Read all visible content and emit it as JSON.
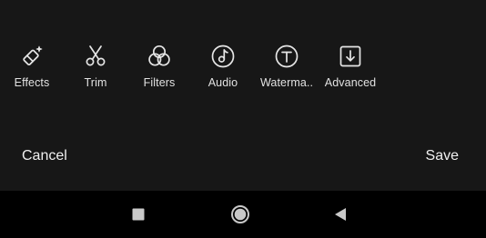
{
  "tools": [
    {
      "label": "Effects",
      "icon": "magic-eraser-icon"
    },
    {
      "label": "Trim",
      "icon": "scissors-icon"
    },
    {
      "label": "Filters",
      "icon": "filters-circles-icon"
    },
    {
      "label": "Audio",
      "icon": "music-note-icon"
    },
    {
      "label": "Waterma..",
      "icon": "text-t-icon"
    },
    {
      "label": "Advanced",
      "icon": "download-box-icon"
    }
  ],
  "actions": {
    "cancel_label": "Cancel",
    "save_label": "Save"
  },
  "navigation": {
    "recents": "square-icon",
    "home": "circle-home-icon",
    "back": "triangle-back-icon"
  },
  "colors": {
    "background": "#171717",
    "nav_background": "#000000",
    "icon": "#e6e6e6"
  }
}
